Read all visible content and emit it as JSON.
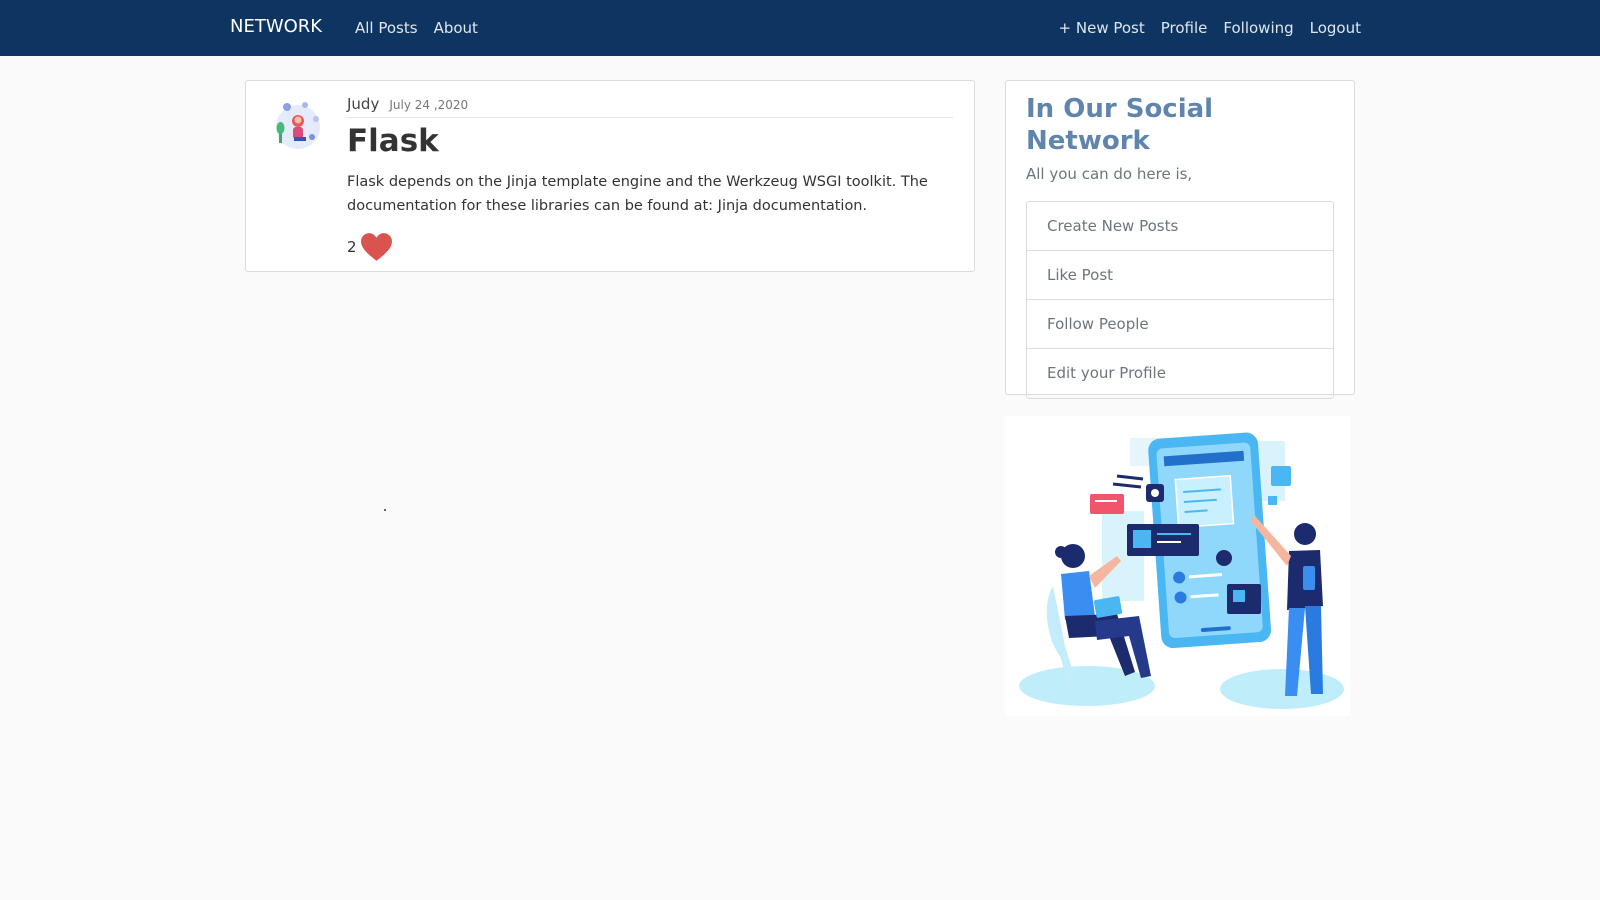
{
  "navbar": {
    "brand": "NETWORK",
    "left_links": [
      "All Posts",
      "About"
    ],
    "right_links": [
      "+ New Post",
      "Profile",
      "Following",
      "Logout"
    ]
  },
  "post": {
    "author": "Judy",
    "date": "July 24 ,2020",
    "title": "Flask",
    "content": "Flask depends on the Jinja template engine and the Werkzeug WSGI toolkit. The documentation for these libraries can be found at: Jinja documentation.",
    "likes": "2"
  },
  "sidebar": {
    "title": "In Our Social Network",
    "subtitle": "All you can do here is,",
    "items": [
      "Create New Posts",
      "Like Post",
      "Follow People",
      "Edit your Profile"
    ]
  },
  "icons": {
    "heart": "heart-icon",
    "avatar": "avatar-illustration",
    "illustration": "social-network-illustration"
  },
  "colors": {
    "navbar": "#0e3461",
    "heart": "#d9534f",
    "sidebar_title": "#5f85ad"
  }
}
